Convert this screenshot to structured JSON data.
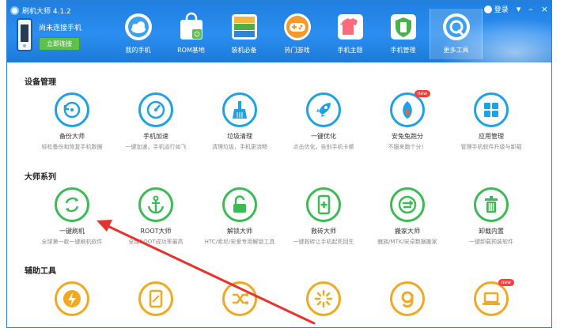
{
  "window": {
    "title": "刷机大师 4.1.2",
    "login_label": "登录",
    "menu_glyph": "▾",
    "minimize_glyph": "–",
    "close_glyph": "×"
  },
  "device": {
    "status": "尚未连接手机",
    "connect_label": "立即连接"
  },
  "nav": [
    {
      "label": "我的手机",
      "icon": "cloud-phone-icon",
      "color": "#3aa0ef"
    },
    {
      "label": "ROM基地",
      "icon": "shopping-bag-icon",
      "color": "#ffffff"
    },
    {
      "label": "装机必备",
      "icon": "app-stack-icon",
      "color": "#f2b63a"
    },
    {
      "label": "热门游戏",
      "icon": "gamepad-icon",
      "color": "#f59a2a"
    },
    {
      "label": "手机主题",
      "icon": "tshirt-icon",
      "color": "#ff6b7a"
    },
    {
      "label": "手机管理",
      "icon": "shield-phone-icon",
      "color": "#45b549"
    },
    {
      "label": "更多工具",
      "icon": "tools-icon",
      "color": "#3aa0ef"
    }
  ],
  "sections": {
    "device_mgmt": "设备管理",
    "master_series": "大师系列",
    "aux_tools": "辅助工具"
  },
  "tools_row1": [
    {
      "name": "备份大师",
      "desc": "轻松备份和恢复手机数据",
      "icon": "backup-icon"
    },
    {
      "name": "手机加速",
      "desc": "一键加速，手机运行如飞",
      "icon": "speedometer-icon"
    },
    {
      "name": "垃圾清理",
      "desc": "清理垃圾，手机更流畅",
      "icon": "broom-icon"
    },
    {
      "name": "一键优化",
      "desc": "点击优化，告别手机卡顿",
      "icon": "rocket-icon"
    },
    {
      "name": "安兔兔跑分",
      "desc": "不服来跑个分！",
      "icon": "antutu-icon",
      "badge": "new"
    },
    {
      "name": "应用管理",
      "desc": "管理手机软件升级与卸载",
      "icon": "app-grid-icon"
    }
  ],
  "tools_row2": [
    {
      "name": "一键刷机",
      "desc": "全球第一款一键刷机软件",
      "icon": "refresh-icon"
    },
    {
      "name": "ROOT大师",
      "desc": "全球ROOT成功率最高",
      "icon": "anchor-icon"
    },
    {
      "name": "解锁大师",
      "desc": "HTC/索尼/安爱专用解锁工具",
      "icon": "unlock-icon"
    },
    {
      "name": "救砖大师",
      "desc": "一键救砖让手机起死回生",
      "icon": "phone-plus-icon"
    },
    {
      "name": "搬家大师",
      "desc": "魅族/MTK/安卓数据搬家",
      "icon": "transfer-icon"
    },
    {
      "name": "卸载内置",
      "desc": "一键卸载预装软件",
      "icon": "trash-icon"
    }
  ],
  "tools_row3": [
    {
      "icon": "bolt-icon"
    },
    {
      "icon": "tablet-icon"
    },
    {
      "icon": "shuffle-icon"
    },
    {
      "icon": "sunburst-icon"
    },
    {
      "icon": "letter-g-icon"
    },
    {
      "icon": "laptop-icon",
      "badge": "new"
    }
  ],
  "colors": {
    "header": "#2b8ef0",
    "blue_ring": "#1da2e6",
    "green_ring": "#3cbb54",
    "orange_ring": "#f2a81f",
    "arrow": "#e8322c"
  }
}
